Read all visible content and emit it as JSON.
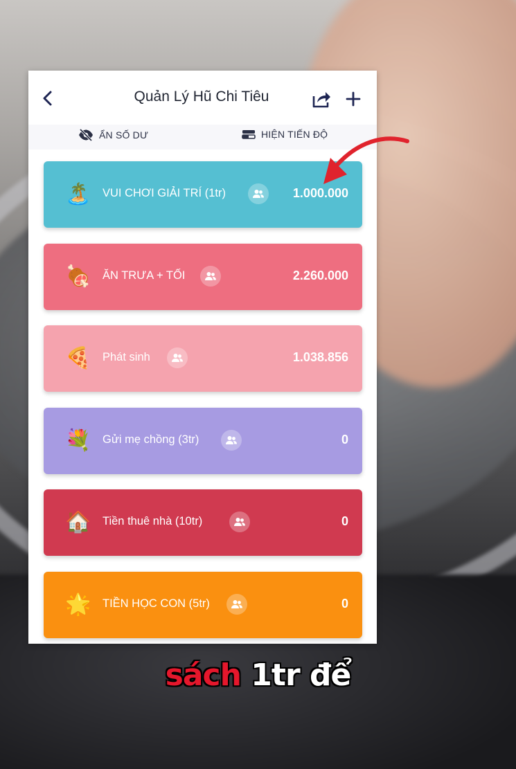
{
  "app": {
    "title": "Quản Lý Hũ Chi Tiêu"
  },
  "toolbar": {
    "hide_balance_label": "ẨN SỐ DƯ",
    "show_progress_label": "HIỆN TIẾN ĐỘ"
  },
  "jars": [
    {
      "emoji": "🏝️",
      "icon_name": "beach-icon",
      "name": "VUI CHƠI GIẢI TRÍ (1tr)",
      "amount": "1.000.000",
      "color": "#55bfd2"
    },
    {
      "emoji": "🍖",
      "icon_name": "meat-icon",
      "name": "ĂN TRƯA + TỐI",
      "amount": "2.260.000",
      "color": "#ee6e80"
    },
    {
      "emoji": "🍕",
      "icon_name": "pizza-icon",
      "name": "Phát sinh",
      "amount": "1.038.856",
      "color": "#f5a3ae"
    },
    {
      "emoji": "💐",
      "icon_name": "bouquet-icon",
      "name": "Gửi mẹ chồng (3tr)",
      "amount": "0",
      "color": "#a79be2"
    },
    {
      "emoji": "🏠",
      "icon_name": "house-icon",
      "name": "Tiền thuê nhà (10tr)",
      "amount": "0",
      "color": "#d03a50"
    },
    {
      "emoji": "🌟",
      "icon_name": "star-icon",
      "name": "TIỀN HỌC CON (5tr)",
      "amount": "0",
      "color": "#fa9010"
    }
  ],
  "caption": {
    "highlight": "sách",
    "rest": "1tr để"
  },
  "colors": {
    "arrow": "#e0232d",
    "text_dark": "#1e2330"
  }
}
